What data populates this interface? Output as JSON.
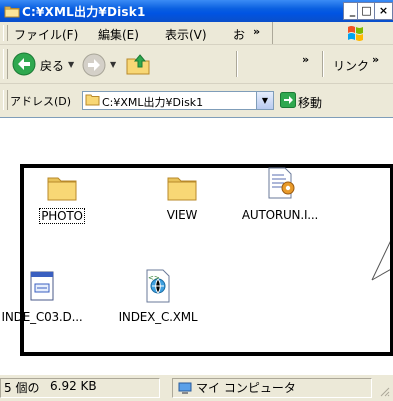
{
  "window": {
    "title": "C:¥XML出力¥Disk1",
    "minimize_label": "_",
    "maximize_label": "□",
    "close_label": "×"
  },
  "menu": {
    "items": [
      "ファイル(F)",
      "編集(E)",
      "表示(V)",
      "お"
    ],
    "overflow": "»"
  },
  "toolbar": {
    "back_label": "戻る",
    "overflow": "»",
    "links_label": "リンク",
    "links_overflow": "»"
  },
  "address": {
    "label": "アドレス(D)",
    "value": "C:¥XML出力¥Disk1",
    "go_label": "移動"
  },
  "files": [
    {
      "name": "PHOTO",
      "type": "folder-icon"
    },
    {
      "name": "VIEW",
      "type": "folder-icon"
    },
    {
      "name": "AUTORUN.I...",
      "type": "ini-file-icon"
    },
    {
      "name": "INDE_C03.D...",
      "type": "document-file-icon"
    },
    {
      "name": "INDEX_C.XML",
      "type": "xml-file-icon"
    }
  ],
  "status": {
    "count": "5 個の",
    "size": "6.92 KB",
    "location": "マイ コンピュータ"
  },
  "colors": {
    "title_blue": "#0054e3",
    "chrome": "#ece9d8",
    "folder": "#f5d76e",
    "go_green": "#2fa84f"
  }
}
